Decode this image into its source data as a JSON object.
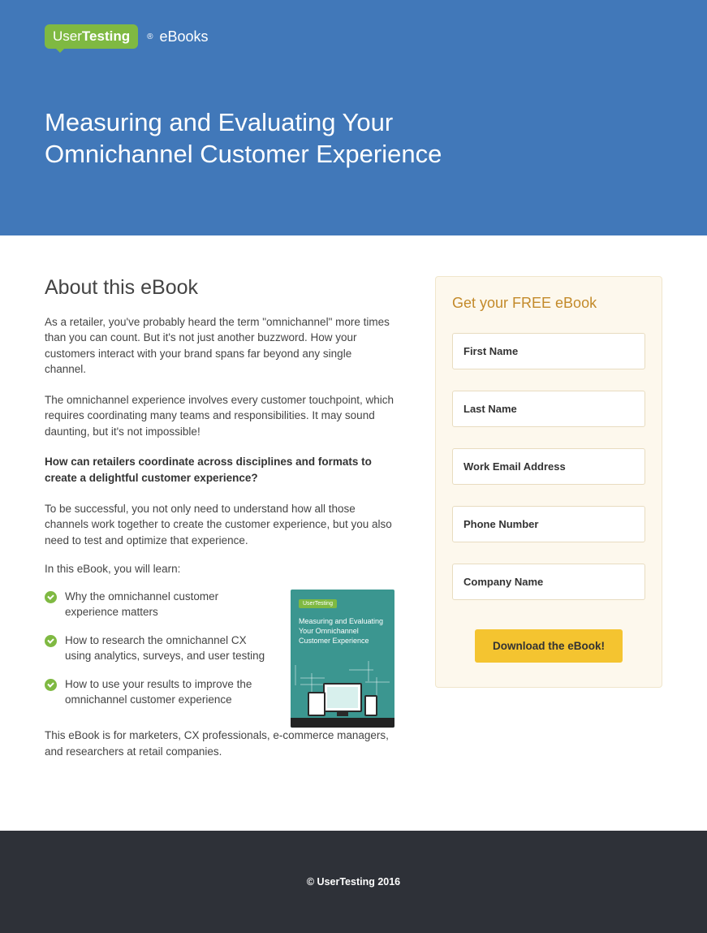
{
  "header": {
    "logo_user": "User",
    "logo_testing": "Testing",
    "logo_sub": "eBooks",
    "title": "Measuring and Evaluating Your Omnichannel Customer Experience"
  },
  "about": {
    "heading": "About this eBook",
    "p1": "As a retailer, you've probably heard the term \"omnichannel\" more times than you can count. But it's not just another buzzword. How your customers interact with your brand spans far beyond any single channel.",
    "p2": "The omnichannel experience involves every customer touchpoint, which requires coordinating many teams and responsibilities. It may sound daunting, but it's not impossible!",
    "p3": "How can retailers coordinate across disciplines and formats to create a delightful customer experience?",
    "p4": "To be successful, you not only need to understand how all those channels work together to create the customer experience, but you also need to test and optimize that experience.",
    "learn_intro": "In this eBook, you will learn:",
    "bullets": [
      "Why the omnichannel customer experience matters",
      "How to research the omnichannel CX using analytics, surveys, and user testing",
      "How to use your results to improve the omnichannel customer experience"
    ],
    "audience": "This eBook is for marketers, CX professionals, e-commerce managers, and researchers at retail companies.",
    "thumb_logo": "UserTesting",
    "thumb_title": "Measuring and Evaluating Your Omnichannel Customer Experience"
  },
  "form": {
    "heading": "Get your FREE eBook",
    "fields": {
      "first_name": "First Name",
      "last_name": "Last Name",
      "email": "Work Email Address",
      "phone": "Phone Number",
      "company": "Company Name"
    },
    "submit": "Download the eBook!"
  },
  "footer": {
    "copyright": "© UserTesting 2016"
  }
}
